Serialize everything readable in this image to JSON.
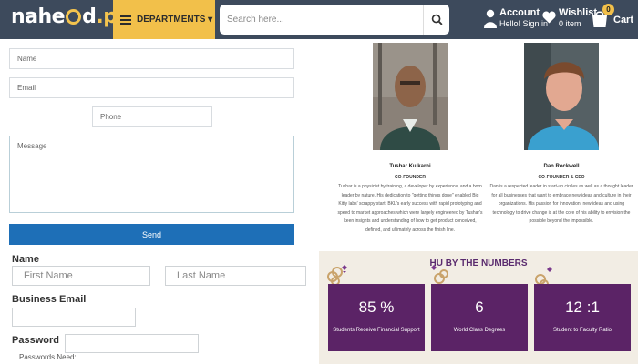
{
  "header": {
    "logo": {
      "part1": "nahe",
      "part2": "d",
      "part3": ".pk"
    },
    "departments_label": "DEPARTMENTS ▾",
    "search_placeholder": "Search here...",
    "account": {
      "title": "Account",
      "subtitle": "Hello! Sign in"
    },
    "wishlist": {
      "title": "Wishlist",
      "subtitle": "0 item"
    },
    "cart": {
      "label": "Cart",
      "count": "0"
    },
    "colors": {
      "bar": "#3d4a5c",
      "accent": "#f2c04a"
    }
  },
  "contact_form": {
    "name_placeholder": "Name",
    "email_placeholder": "Email",
    "phone_placeholder": "Phone",
    "message_placeholder": "Message",
    "send_label": "Send",
    "send_color": "#1e6fb7"
  },
  "signup_form": {
    "name_label": "Name",
    "first_name_placeholder": "First Name",
    "last_name_placeholder": "Last Name",
    "email_label": "Business Email",
    "password_label": "Password",
    "password_hint": "Passwords Need:"
  },
  "team": [
    {
      "name": "Tushar Kulkarni",
      "role": "CO-FOUNDER",
      "bio": [
        "Tushar is a physicist by training, a developer by experience, and a born",
        "leader by nature. His dedication to \"getting things done\" enabled Big",
        "Kitty labs' scrappy start. BKL's early success with rapid prototyping and",
        "speed to market approaches which were largely engineered by Tushar's",
        "keen insights and understanding of how to get product conceived,",
        "defined, and ultimately across the finish line."
      ]
    },
    {
      "name": "Dan Rockwell",
      "role": "CO-FOUNDER & CEO",
      "bio": [
        "Dan is a respected leader in start-up circles as well as a thought leader",
        "for all businesses that want to embrace new ideas and culture in their",
        "organizations. His passion for innovation, new ideas and using",
        "technology to drive change is at the core of his ability to envision the",
        "possible beyond the impossible."
      ]
    }
  ],
  "numbers": {
    "title": "HU BY THE NUMBERS",
    "stats": [
      {
        "value": "85 %",
        "caption": "Students Receive Financial Support"
      },
      {
        "value": "6",
        "caption": "World Class Degrees"
      },
      {
        "value": "12 :1",
        "caption": "Student to Faculty Ratio"
      }
    ],
    "colors": {
      "box": "#5b2366",
      "background": "#f2ede4"
    }
  }
}
